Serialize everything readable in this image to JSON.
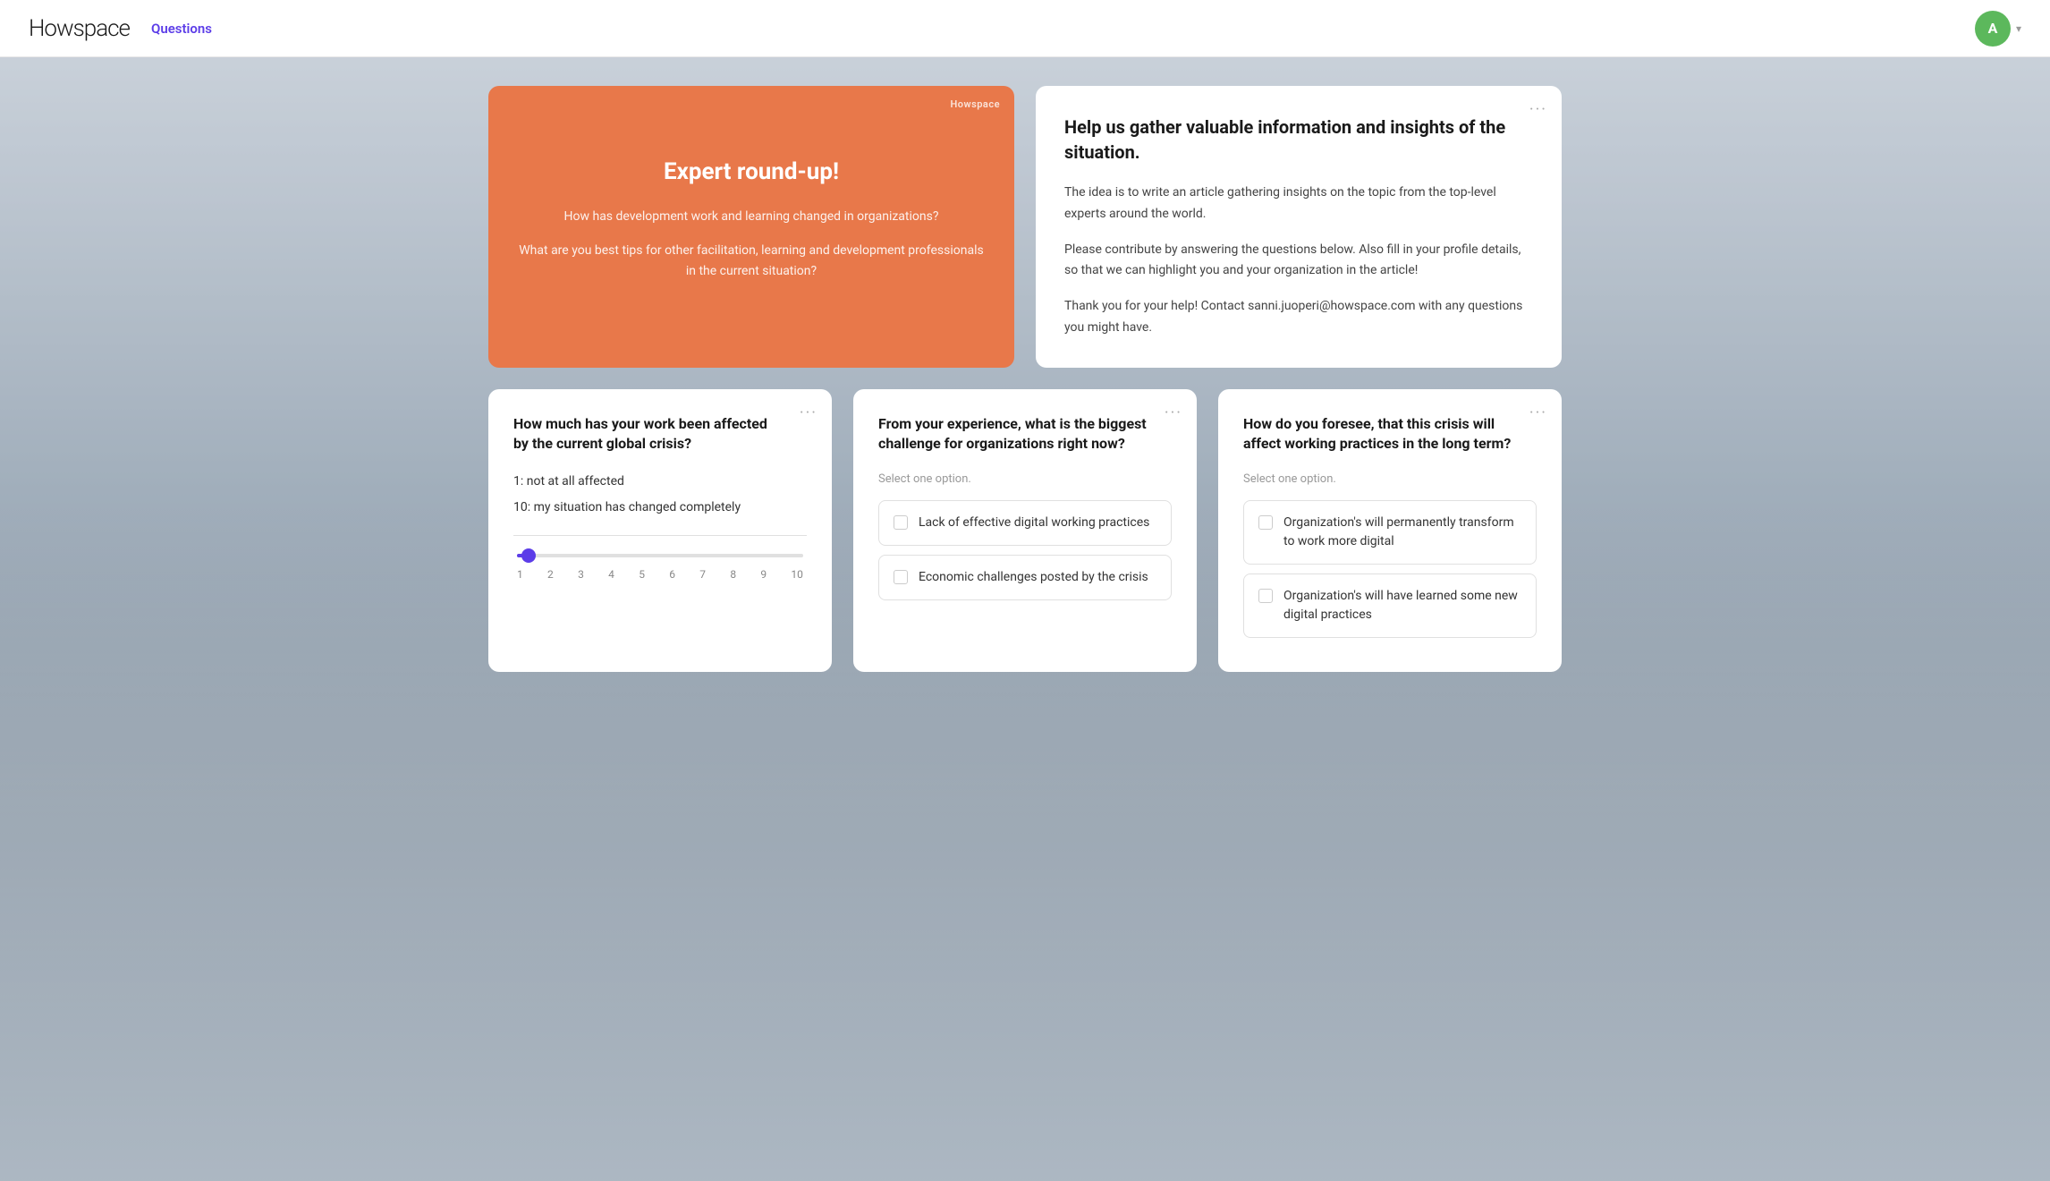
{
  "navbar": {
    "logo": "Howspace",
    "nav_link": "Questions",
    "avatar_letter": "A",
    "chevron": "▾"
  },
  "orange_card": {
    "brand": "Howspace",
    "title": "Expert round-up!",
    "subtitle1": "How has development work and learning changed in organizations?",
    "subtitle2": "What are you best tips for other facilitation, learning and development professionals in the current situation?"
  },
  "info_card": {
    "dots": "···",
    "heading": "Help us gather valuable information and insights of the situation.",
    "para1": "The idea is to write an article gathering insights on the topic from the top-level experts around the world.",
    "para2": "Please contribute by answering the questions below. Also fill in your profile details, so that we can highlight you and your organization in the article!",
    "para3": "Thank you for your help! Contact sanni.juoperi@howspace.com with any questions you might have."
  },
  "question_cards": [
    {
      "id": "q1",
      "dots": "···",
      "title": "How much has your work been affected by the current global crisis?",
      "slider": {
        "label1": "1: not at all affected",
        "label2": "10: my situation has changed completely",
        "ticks": [
          "1",
          "2",
          "3",
          "4",
          "5",
          "6",
          "7",
          "8",
          "9",
          "10"
        ],
        "value": 1
      }
    },
    {
      "id": "q2",
      "dots": "···",
      "title": "From your experience, what is the biggest challenge for organizations right now?",
      "select_label": "Select one option.",
      "options": [
        "Lack of effective digital working practices",
        "Economic challenges posted by the crisis"
      ]
    },
    {
      "id": "q3",
      "dots": "···",
      "title": "How do you foresee, that this crisis will affect working practices in the long term?",
      "select_label": "Select one option.",
      "options": [
        "Organization's will permanently transform to work more digital",
        "Organization's will have learned some new digital practices"
      ]
    }
  ]
}
